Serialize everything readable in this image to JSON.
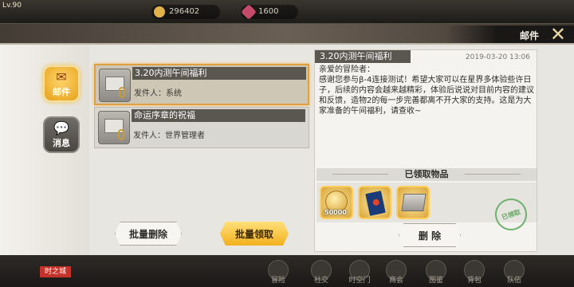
{
  "topbar": {
    "level": "Lv.90",
    "gold": "296402",
    "gems": "1600"
  },
  "window": {
    "title": "邮件",
    "close": "✕"
  },
  "tabs": [
    {
      "label": "邮件",
      "icon": "mail-icon"
    },
    {
      "label": "消息",
      "icon": "chat-bubble-icon"
    }
  ],
  "mails": [
    {
      "subject": "3.20内测午间福利",
      "sender": "发件人：系统",
      "selected": true
    },
    {
      "subject": "命运序章的祝福",
      "sender": "发件人：世界管理者",
      "selected": false
    }
  ],
  "buttons": {
    "batch_delete": "批量删除",
    "batch_claim": "批量领取",
    "delete": "删 除"
  },
  "detail": {
    "title": "3.20内测午间福利",
    "date": "2019-03-20  13:06",
    "greeting": "亲爱的冒险者：",
    "body": "感谢您参与β-4连接测试！希望大家可以在星界多体验些许日子，后续的内容会越来越精彩，体验后说说对目前内容的建议和反馈，造物2的每一步完善都离不开大家的支持。这是为大家准备的午间福利，请查收~",
    "attachments_header": "已领取物品",
    "attachments": [
      {
        "icon": "gold-coin-icon",
        "qty": "50000"
      },
      {
        "icon": "card-pack-icon",
        "qty": ""
      },
      {
        "icon": "material-crate-icon",
        "qty": ""
      }
    ],
    "stamp": "已领取"
  },
  "bottom": {
    "tag": "时之城",
    "nav": [
      "冒险",
      "社交",
      "时空门",
      "商会",
      "图鉴",
      "背包",
      "队伍"
    ]
  },
  "colors": {
    "accent_gold": "#f2b01e",
    "selected_border": "#e0a040",
    "dark_header": "#5a5650"
  }
}
